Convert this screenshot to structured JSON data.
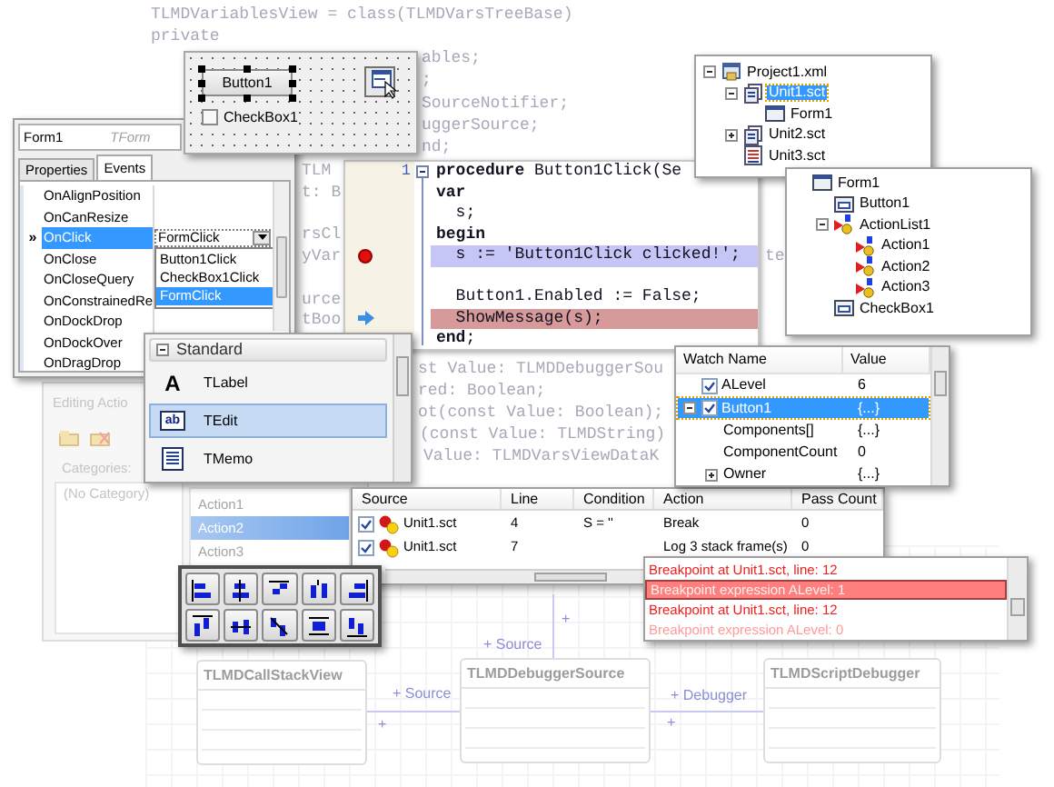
{
  "background_code": [
    "TLMDVariablesView = class(TLMDVarsTreeBase)",
    "private",
    "ables;",
    ";",
    "SourceNotifier;",
    "uggerSource;",
    "nd;",
    "TLM",
    "t: B",
    "rsCl",
    "yVar",
    "urce",
    "tBoo",
    "te",
    "st Value: TLMDDebuggerSou",
    "red: Boolean;",
    "ot(const Value: Boolean);",
    "(const Value: TLMDString)",
    "Value: TLMDVarsViewDataK"
  ],
  "diagram": {
    "classes": [
      {
        "title": "TLMDCallStackView"
      },
      {
        "title": "TLMDDebuggerSource"
      },
      {
        "title": "TLMDScriptDebugger"
      }
    ],
    "links": [
      "+ Source",
      "+ Source",
      "+ Debugger",
      "+",
      "+",
      "+"
    ]
  },
  "editing_actions": {
    "title": "Editing Actio",
    "categories_label": "Categories:",
    "categories": [
      "(No Category)"
    ],
    "actions": [
      {
        "label": "Action1",
        "selected": false
      },
      {
        "label": "Action2",
        "selected": true
      },
      {
        "label": "Action3",
        "selected": false
      }
    ]
  },
  "code_editor": {
    "line_number": "1",
    "folding": true,
    "lines": [
      {
        "text": "**procedure** Button1Click(Se",
        "bold": false,
        "kind": "plain"
      },
      {
        "text": "var",
        "bold": true,
        "kind": "plain"
      },
      {
        "text": "  s;",
        "bold": false,
        "kind": "plain"
      },
      {
        "text": "begin",
        "bold": true,
        "kind": "plain"
      },
      {
        "text": "  s := 'Button1Click clicked!';",
        "bold": false,
        "kind": "breakpoint"
      },
      {
        "kind": "blank"
      },
      {
        "text": "  Button1.Enabled := False;",
        "bold": false,
        "kind": "plain"
      },
      {
        "text": "  ShowMessage(s);",
        "bold": false,
        "kind": "execution"
      },
      {
        "text": "**end**;",
        "bold": false,
        "kind": "plain"
      }
    ]
  },
  "object_inspector": {
    "object": "Form1",
    "class": "TForm",
    "tabs": [
      {
        "label": "Properties",
        "selected": false
      },
      {
        "label": "Events",
        "selected": true
      }
    ],
    "marker": "»",
    "events": [
      {
        "name": "OnAlignPosition",
        "selected": false
      },
      {
        "name": "OnCanResize",
        "selected": false
      },
      {
        "name": "OnClick",
        "selected": true
      },
      {
        "name": "OnClose",
        "selected": false
      },
      {
        "name": "OnCloseQuery",
        "selected": false
      },
      {
        "name": "OnConstrainedRe",
        "selected": false
      },
      {
        "name": "OnDockDrop",
        "selected": false
      },
      {
        "name": "OnDockOver",
        "selected": false
      },
      {
        "name": "OnDragDrop",
        "selected": false
      }
    ],
    "value": "FormClick",
    "dropdown": [
      {
        "label": "Button1Click",
        "selected": false
      },
      {
        "label": "CheckBox1Click",
        "selected": false
      },
      {
        "label": "FormClick",
        "selected": true
      }
    ]
  },
  "form_designer": {
    "button": "Button1",
    "button_selected": true,
    "checkbox": {
      "label": "CheckBox1",
      "checked": false
    }
  },
  "component_palette": {
    "category": "Standard",
    "expanded": true,
    "items": [
      {
        "label": "TLabel",
        "kind": "label",
        "icon": "A",
        "selected": false
      },
      {
        "label": "TEdit",
        "kind": "edit",
        "icon": "ab",
        "selected": true
      },
      {
        "label": "TMemo",
        "kind": "memo",
        "selected": false
      }
    ]
  },
  "breakpoints": {
    "columns": [
      "Source",
      "Line",
      "Condition",
      "Action",
      "Pass Count"
    ],
    "rows": [
      {
        "enabled": true,
        "source": "Unit1.sct",
        "line": "4",
        "condition": "S = ''",
        "action": "Break",
        "pass_count": "0"
      },
      {
        "enabled": true,
        "source": "Unit1.sct",
        "line": "7",
        "action": "Log 3 stack frame(s)",
        "pass_count": "0"
      }
    ]
  },
  "project_tree": [
    {
      "label": "Project1.xml",
      "kind": "project",
      "expanded": true,
      "selected": false,
      "children": [
        {
          "label": "Unit1.sct",
          "kind": "unit",
          "expanded": true,
          "selected": true,
          "children": [
            {
              "label": "Form1",
              "kind": "form",
              "selected": false
            }
          ]
        },
        {
          "label": "Unit2.sct",
          "kind": "unit",
          "expanded": false,
          "selected": false
        },
        {
          "label": "Unit3.sct",
          "kind": "script",
          "selected": false
        }
      ]
    }
  ],
  "component_tree": [
    {
      "label": "Form1",
      "kind": "form",
      "selected": false,
      "children": [
        {
          "label": "Button1",
          "kind": "control",
          "selected": false
        },
        {
          "label": "ActionList1",
          "kind": "actionlist",
          "expanded": true,
          "selected": false,
          "children": [
            {
              "label": "Action1",
              "kind": "action",
              "selected": false
            },
            {
              "label": "Action2",
              "kind": "action",
              "selected": false
            },
            {
              "label": "Action3",
              "kind": "action",
              "selected": false
            }
          ]
        },
        {
          "label": "CheckBox1",
          "kind": "control",
          "selected": false
        }
      ]
    }
  ],
  "watches": {
    "columns": [
      "Watch Name",
      "Value"
    ],
    "rows": [
      {
        "name": "ALevel",
        "value": "6",
        "checked": true,
        "selected": false
      },
      {
        "name": "Button1",
        "value": "{...}",
        "checked": true,
        "selected": true,
        "expanded": true,
        "children": [
          {
            "name": "Components[]",
            "value": "{...}"
          },
          {
            "name": "ComponentCount",
            "value": "0"
          },
          {
            "name": "Owner",
            "value": "{...}",
            "expanded": false
          }
        ]
      }
    ]
  },
  "log": [
    {
      "text": "Breakpoint at Unit1.sct, line: 12",
      "kind": "location",
      "selected": false
    },
    {
      "text": "Breakpoint expression ALevel: 1",
      "kind": "expression",
      "selected": true
    },
    {
      "text": "Breakpoint at Unit1.sct, line: 12",
      "kind": "location",
      "selected": false
    },
    {
      "text": "Breakpoint expression ALevel: 0",
      "kind": "expression",
      "selected": false
    }
  ]
}
